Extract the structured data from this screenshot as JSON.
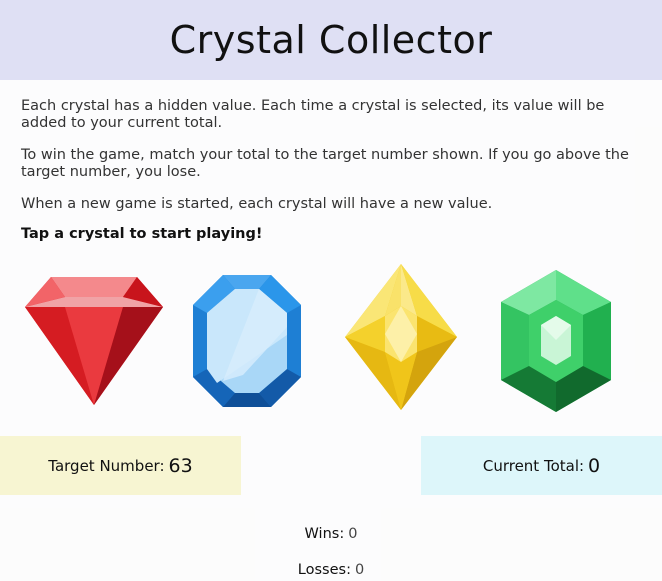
{
  "header": {
    "title": "Crystal Collector"
  },
  "instructions": {
    "p1": "Each crystal has a hidden value. Each time a crystal is selected, its value will be added to your current total.",
    "p2": "To win the game, match your total to the target number shown. If you go above the target number, you lose.",
    "p3": "When a new game is started, each crystal will have a new value.",
    "cta": "Tap a crystal to start playing!"
  },
  "crystals": [
    {
      "name": "red-crystal",
      "icon": "red-gem-icon",
      "color": "#e52328"
    },
    {
      "name": "blue-crystal",
      "icon": "blue-gem-icon",
      "color": "#1e88e5"
    },
    {
      "name": "yellow-crystal",
      "icon": "yellow-gem-icon",
      "color": "#f5d21f"
    },
    {
      "name": "green-crystal",
      "icon": "green-gem-icon",
      "color": "#1fb24a"
    }
  ],
  "target": {
    "label": "Target Number:",
    "value": "63"
  },
  "current": {
    "label": "Current Total:",
    "value": "0"
  },
  "stats": {
    "wins_label": "Wins:",
    "wins": "0",
    "losses_label": "Losses:",
    "losses": "0"
  },
  "colors": {
    "header_bg": "#dfe0f4",
    "target_bg": "#f7f5d2",
    "total_bg": "#ddf6fa"
  }
}
